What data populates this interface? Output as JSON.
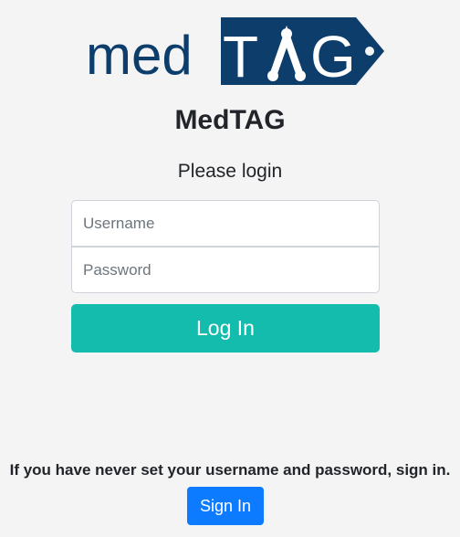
{
  "logo": {
    "text_left": "med",
    "text_tag": "TAG",
    "color_dark": "#0c3d6b"
  },
  "app_title": "MedTAG",
  "subtitle": "Please login",
  "username": {
    "placeholder": "Username",
    "value": ""
  },
  "password": {
    "placeholder": "Password",
    "value": ""
  },
  "login_button": "Log In",
  "note": "If you have never set your username and password, sign in.",
  "signin_button": "Sign In",
  "colors": {
    "accent": "#13bcad",
    "primary": "#0d7bff",
    "background": "#f4f4f5"
  }
}
